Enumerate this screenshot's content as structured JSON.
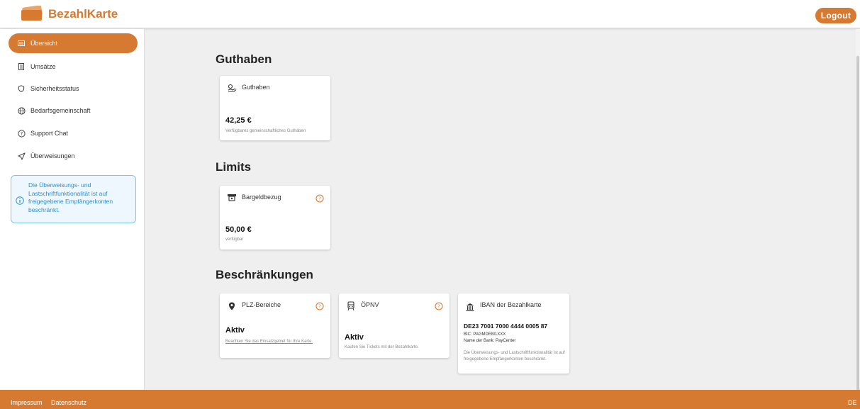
{
  "header": {
    "app_name": "BezahlKarte",
    "logout_label": "Logout"
  },
  "sidebar": {
    "items": [
      {
        "label": "Übersicht",
        "icon": "list-icon",
        "active": true
      },
      {
        "label": "Umsätze",
        "icon": "receipt-icon",
        "active": false
      },
      {
        "label": "Sicherheitsstatus",
        "icon": "shield-icon",
        "active": false
      },
      {
        "label": "Bedarfsgemeinschaft",
        "icon": "globe-icon",
        "active": false
      },
      {
        "label": "Support Chat",
        "icon": "help-circle-icon",
        "active": false
      },
      {
        "label": "Überweisungen",
        "icon": "send-icon",
        "active": false
      }
    ],
    "info_text": "Die Überweisungs- und Lastschriftfunktionalität ist auf freigegebene Empfängerkonten beschränkt."
  },
  "sections": {
    "guthaben": {
      "title": "Guthaben",
      "card": {
        "title": "Guthaben",
        "amount": "42,25 €",
        "subtitle": "Verfügbares gemeinschaftliches Guthaben"
      }
    },
    "limits": {
      "title": "Limits",
      "card": {
        "title": "Bargeldbezug",
        "amount": "50,00 €",
        "subtitle": "verfügbar"
      }
    },
    "restrictions": {
      "title": "Beschränkungen",
      "plz": {
        "title": "PLZ-Bereiche",
        "status": "Aktiv",
        "link": "Beachten Sie das Einsatzgebiet für Ihre Karte."
      },
      "oepnv": {
        "title": "ÖPNV",
        "status": "Aktiv",
        "subtitle": "Kaufen Sie Tickets mit der Bezahlkarte."
      },
      "iban": {
        "title": "IBAN der Bezahlkarte",
        "iban": "DE23 7001 7000 4444 0005 87",
        "bic": "BIC: PAGMDEM1XXX",
        "bank": "Name der Bank: PayCenter",
        "note": "Die Überweisungs- und Lastschriftfunktionalität ist auf freigegebene Empfängerkonten beschränkt."
      }
    }
  },
  "footer": {
    "impressum": "Impressum",
    "datenschutz": "Datenschutz",
    "language": "DE"
  },
  "colors": {
    "accent": "#d67a31",
    "info": "#2a8fd3"
  }
}
